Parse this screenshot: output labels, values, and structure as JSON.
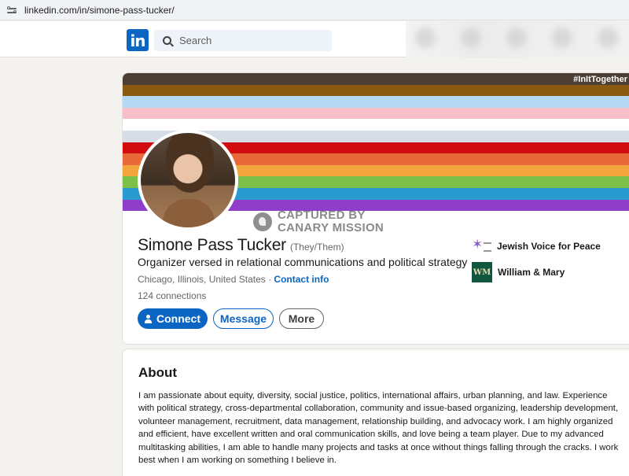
{
  "browser": {
    "url": "linkedin.com/in/simone-pass-tucker/"
  },
  "nav": {
    "logo": "in",
    "search_placeholder": "Search"
  },
  "banner": {
    "hashtag": "#InItTogether",
    "stripes": [
      "#4d3f33",
      "#8a5a10",
      "#b5d9f5",
      "#f7bfc9",
      "#ffffff",
      "#d7dde6",
      "#d10d10",
      "#e86a3b",
      "#f3a53b",
      "#7cc04a",
      "#2a9bcf",
      "#8f3ec9"
    ]
  },
  "watermark": {
    "line1": "CAPTURED BY",
    "line2": "CANARY MISSION"
  },
  "profile": {
    "name": "Simone Pass Tucker",
    "pronouns": "(They/Them)",
    "headline": "Organizer versed in relational communications and political strategy",
    "location": "Chicago, Illinois, United States",
    "separator": " · ",
    "contact_label": "Contact info",
    "connections": "124 connections"
  },
  "actions": {
    "connect": "Connect",
    "message": "Message",
    "more": "More"
  },
  "orgs": [
    {
      "name": "Jewish Voice for Peace",
      "logo": "jvp-logo"
    },
    {
      "name": "William & Mary",
      "logo": "wm-logo"
    }
  ],
  "about": {
    "title": "About",
    "text": "I am passionate about equity, diversity, social justice, politics, international affairs, urban planning, and law. Experience with political strategy, cross-departmental collaboration, community and issue-based organizing, leadership development, volunteer management, recruitment, data management, relationship building, and advocacy work. I am highly organized and efficient, have excellent written and oral communication skills, and love being a team player. Due to my advanced multitasking abilities, I am able to handle many projects and tasks at once without things falling through the cracks. I work best when I am working on something I believe in."
  }
}
